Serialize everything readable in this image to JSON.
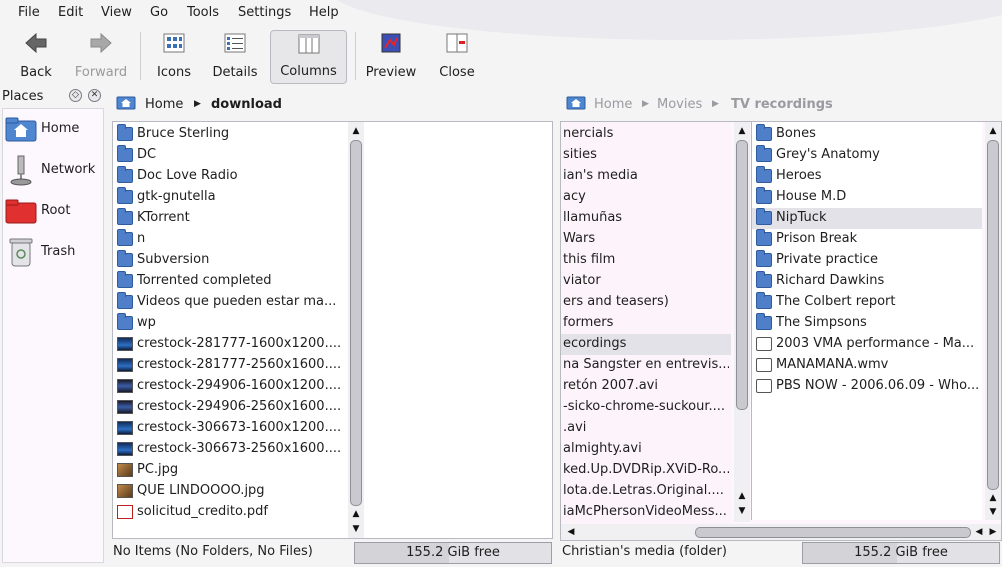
{
  "menu": [
    "File",
    "Edit",
    "View",
    "Go",
    "Tools",
    "Settings",
    "Help"
  ],
  "toolbar": {
    "back": "Back",
    "forward": "Forward",
    "icons": "Icons",
    "details": "Details",
    "columns": "Columns",
    "preview": "Preview",
    "close": "Close"
  },
  "places": {
    "title": "Places",
    "items": [
      "Home",
      "Network",
      "Root",
      "Trash"
    ]
  },
  "left": {
    "crumbs": [
      "Home",
      "download"
    ],
    "files": [
      {
        "name": "Bruce Sterling",
        "type": "folder"
      },
      {
        "name": "DC",
        "type": "folder"
      },
      {
        "name": "Doc Love Radio",
        "type": "folder"
      },
      {
        "name": "gtk-gnutella",
        "type": "folder"
      },
      {
        "name": "KTorrent",
        "type": "folder"
      },
      {
        "name": "n",
        "type": "folder"
      },
      {
        "name": "Subversion",
        "type": "folder"
      },
      {
        "name": "Torrented completed",
        "type": "folder"
      },
      {
        "name": "Videos que pueden estar ma...",
        "type": "folder"
      },
      {
        "name": "wp",
        "type": "folder"
      },
      {
        "name": "crestock-281777-1600x1200....",
        "type": "image"
      },
      {
        "name": "crestock-281777-2560x1600....",
        "type": "image"
      },
      {
        "name": "crestock-294906-1600x1200....",
        "type": "image2"
      },
      {
        "name": "crestock-294906-2560x1600....",
        "type": "image2"
      },
      {
        "name": "crestock-306673-1600x1200....",
        "type": "image"
      },
      {
        "name": "crestock-306673-2560x1600....",
        "type": "image"
      },
      {
        "name": "PC.jpg",
        "type": "jpg"
      },
      {
        "name": "QUE LINDOOOO.jpg",
        "type": "jpg"
      },
      {
        "name": "solicitud_credito.pdf",
        "type": "pdf"
      }
    ],
    "status": "No Items (No Folders, No Files)",
    "free": "155.2 GiB free",
    "used_fraction": 0.48
  },
  "right": {
    "crumbs": [
      "Home",
      "Movies",
      "TV recordings"
    ],
    "movies": [
      "nercials",
      "sities",
      "ian's media",
      "acy",
      "llamuñas",
      "Wars",
      "this film",
      "viator",
      "ers and teasers)",
      "formers",
      "ecordings",
      "na Sangster en entrevis...",
      "retón 2007.avi",
      "-sicko-chrome-suckour....",
      ".avi",
      "almighty.avi",
      "ked.Up.DVDRip.XViD-Ro...",
      "lota.de.Letras.Original....",
      "iaMcPhersonVideoMess..."
    ],
    "movies_selected": 10,
    "tv": [
      {
        "name": "Bones",
        "type": "folder"
      },
      {
        "name": "Grey's Anatomy",
        "type": "folder"
      },
      {
        "name": "Heroes",
        "type": "folder"
      },
      {
        "name": "House M.D",
        "type": "folder"
      },
      {
        "name": "NipTuck",
        "type": "folder"
      },
      {
        "name": "Prison Break",
        "type": "folder"
      },
      {
        "name": "Private practice",
        "type": "folder"
      },
      {
        "name": "Richard Dawkins",
        "type": "folder"
      },
      {
        "name": "The Colbert report",
        "type": "folder"
      },
      {
        "name": "The Simpsons",
        "type": "folder"
      },
      {
        "name": "2003 VMA performance - Ma...",
        "type": "video"
      },
      {
        "name": "MANAMANA.wmv",
        "type": "video"
      },
      {
        "name": "PBS NOW - 2006.06.09 - Who...",
        "type": "video"
      }
    ],
    "tv_selected": 4,
    "status": "Christian's media (folder)",
    "free": "155.2 GiB free",
    "used_fraction": 0.48
  },
  "icons": {
    "back": "arrow-left-icon",
    "forward": "arrow-right-icon",
    "icons": "icon-view-icon",
    "details": "details-view-icon",
    "columns": "columns-view-icon",
    "preview": "preview-icon",
    "close": "close-split-icon"
  }
}
